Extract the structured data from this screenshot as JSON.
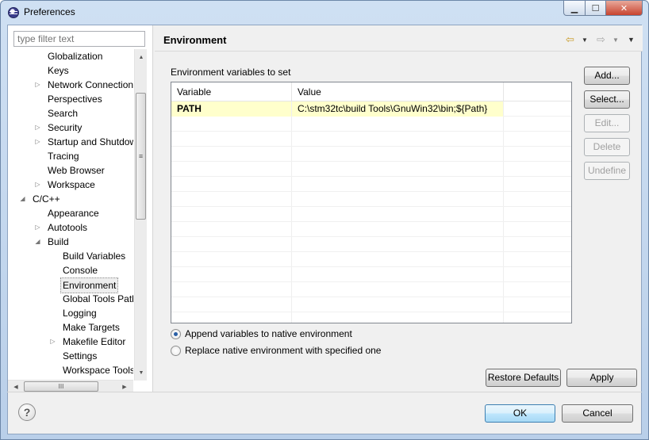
{
  "window": {
    "title": "Preferences"
  },
  "filter": {
    "placeholder": "type filter text"
  },
  "tree": [
    {
      "label": "Globalization",
      "expander": ""
    },
    {
      "label": "Keys",
      "expander": ""
    },
    {
      "label": "Network Connection",
      "expander": "▷"
    },
    {
      "label": "Perspectives",
      "expander": ""
    },
    {
      "label": "Search",
      "expander": ""
    },
    {
      "label": "Security",
      "expander": "▷"
    },
    {
      "label": "Startup and Shutdown",
      "expander": "▷"
    },
    {
      "label": "Tracing",
      "expander": ""
    },
    {
      "label": "Web Browser",
      "expander": ""
    },
    {
      "label": "Workspace",
      "expander": "▷"
    },
    {
      "label": "C/C++",
      "expander": "◢"
    },
    {
      "label": "Appearance",
      "expander": ""
    },
    {
      "label": "Autotools",
      "expander": "▷"
    },
    {
      "label": "Build",
      "expander": "◢"
    },
    {
      "label": "Build Variables",
      "expander": ""
    },
    {
      "label": "Console",
      "expander": ""
    },
    {
      "label": "Environment",
      "expander": "",
      "selected": true
    },
    {
      "label": "Global Tools Paths",
      "expander": ""
    },
    {
      "label": "Logging",
      "expander": ""
    },
    {
      "label": "Make Targets",
      "expander": ""
    },
    {
      "label": "Makefile Editor",
      "expander": "▷"
    },
    {
      "label": "Settings",
      "expander": ""
    },
    {
      "label": "Workspace Tools",
      "expander": ""
    }
  ],
  "page": {
    "title": "Environment",
    "section_label": "Environment variables to set"
  },
  "table": {
    "columns": [
      "Variable",
      "Value"
    ],
    "rows": [
      {
        "variable": "PATH",
        "value": "C:\\stm32tc\\build Tools\\GnuWin32\\bin;${Path}"
      }
    ]
  },
  "side_buttons": {
    "add": "Add...",
    "select": "Select...",
    "edit": "Edit...",
    "delete": "Delete",
    "undefine": "Undefine"
  },
  "radios": {
    "append": "Append variables to native environment",
    "replace": "Replace native environment with specified one",
    "selected": "append"
  },
  "buttons": {
    "restore_defaults": "Restore Defaults",
    "apply": "Apply",
    "ok": "OK",
    "cancel": "Cancel"
  },
  "icons": {
    "help": "?",
    "scroll_grip_v": "≡",
    "scroll_grip_h": "III"
  }
}
